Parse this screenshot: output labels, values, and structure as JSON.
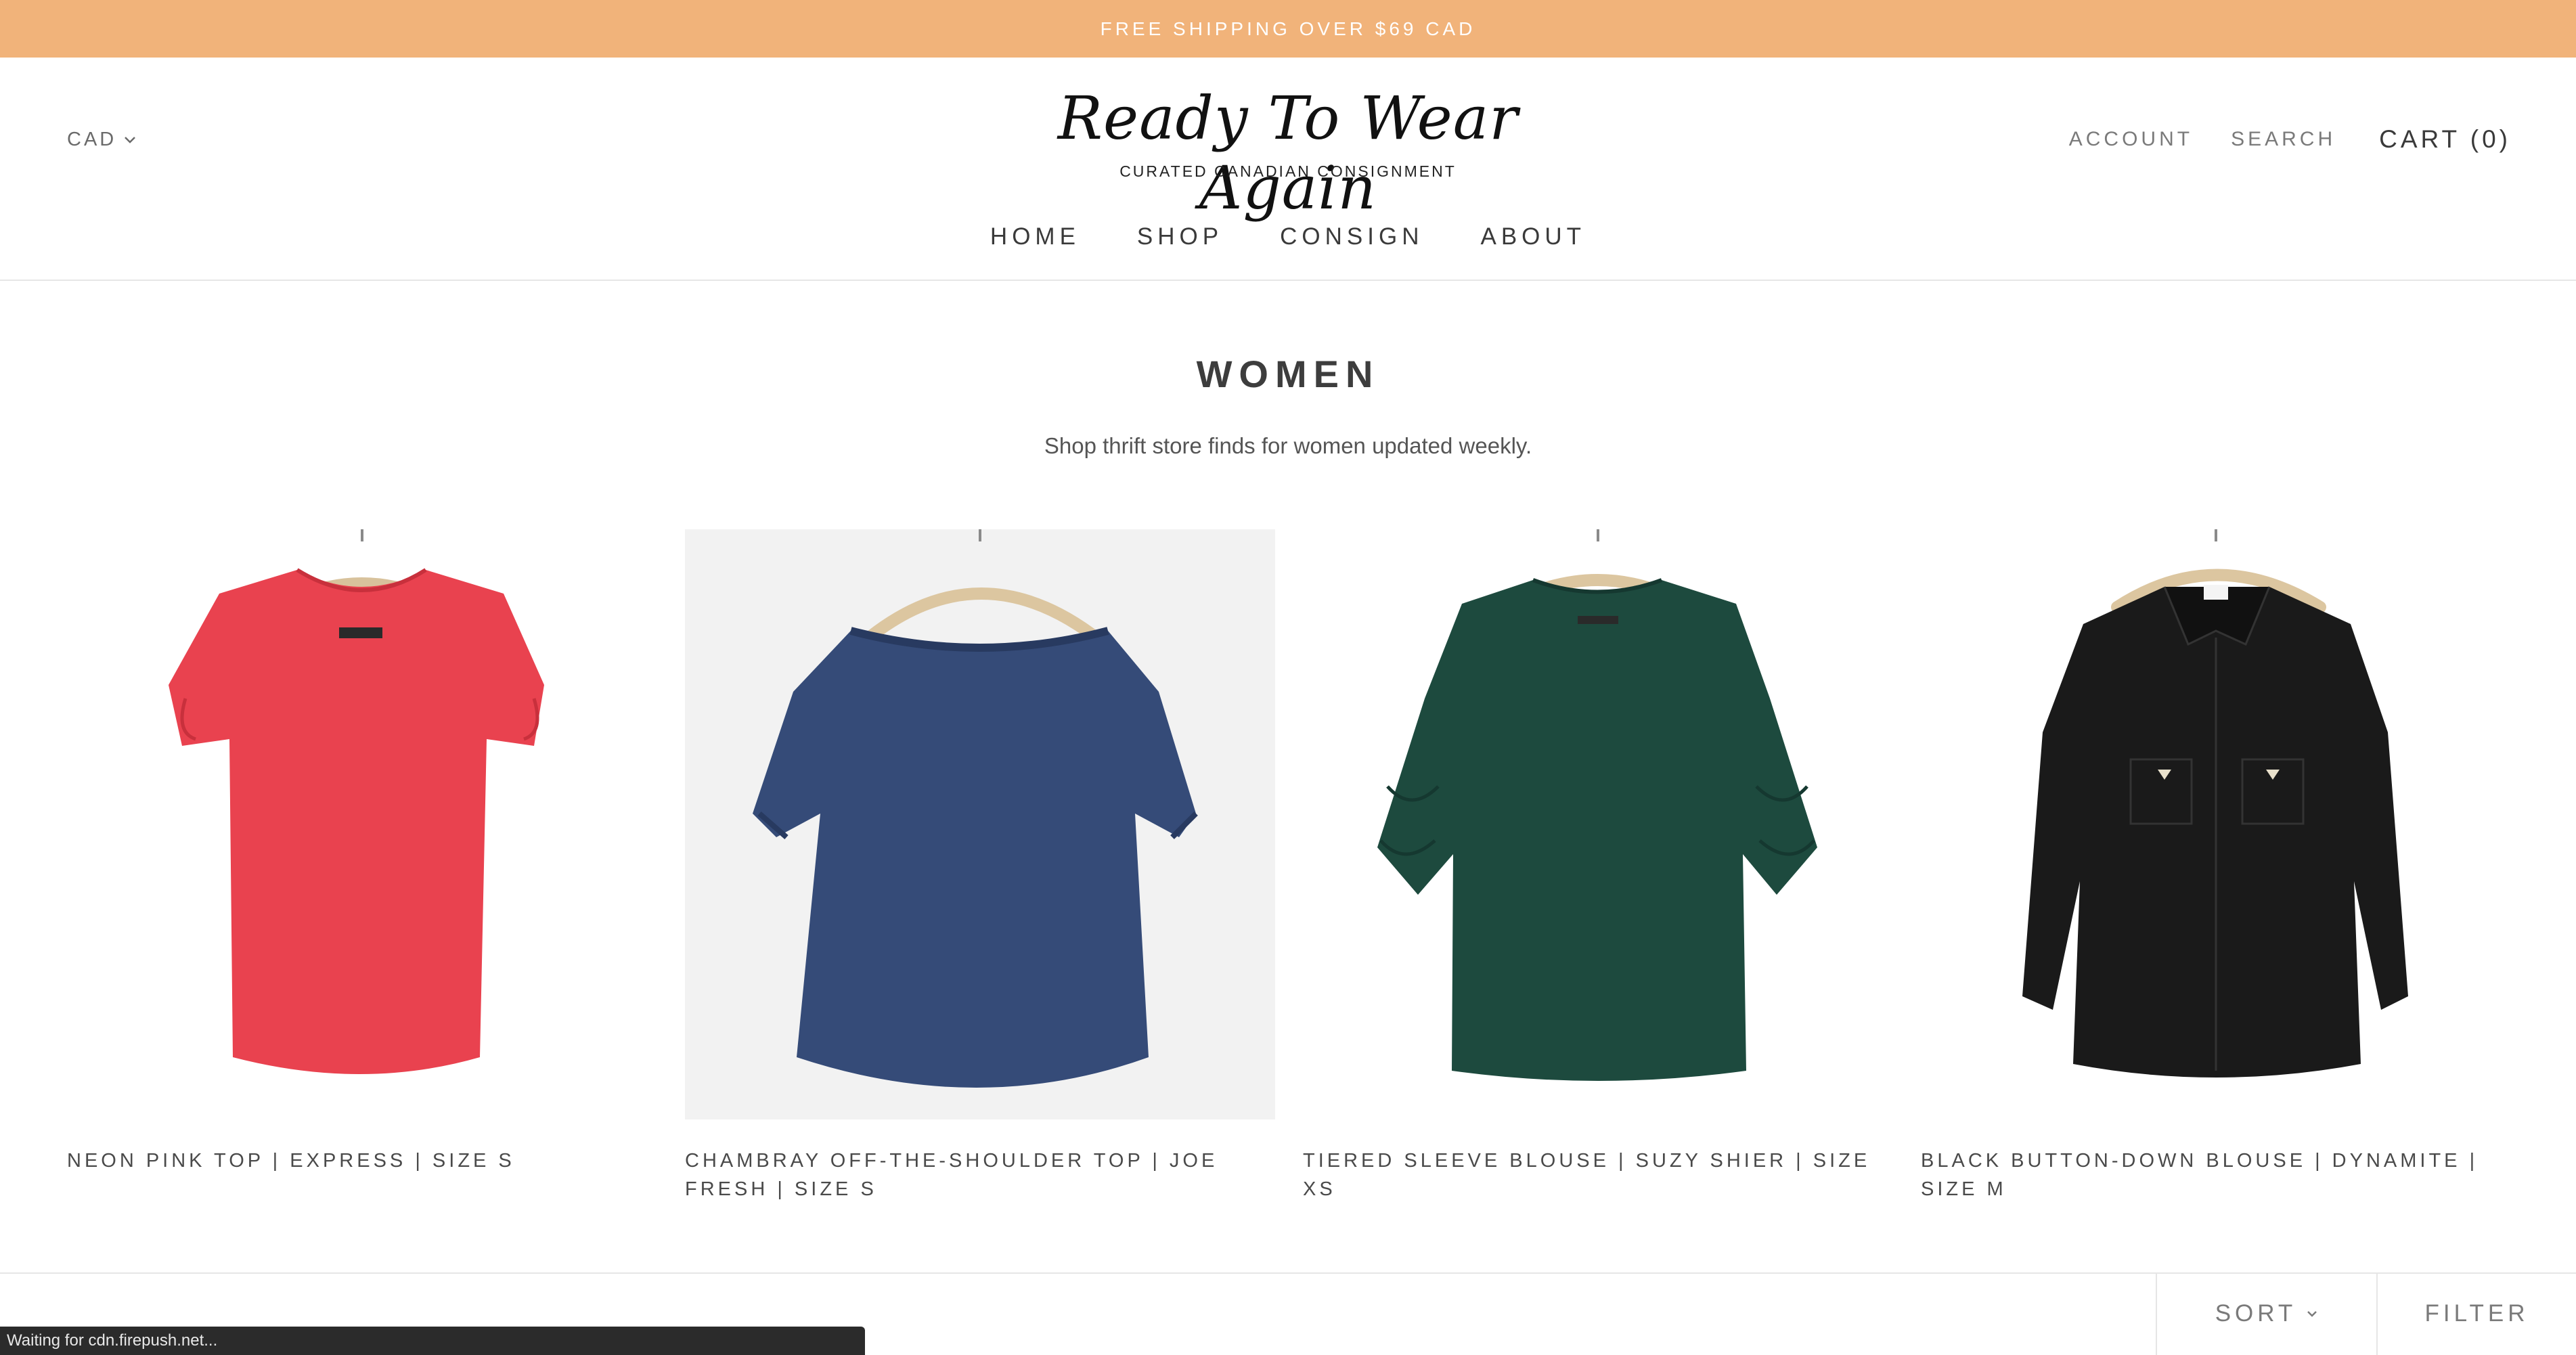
{
  "announcement": {
    "text": "FREE SHIPPING OVER $69 CAD"
  },
  "header": {
    "currency": "CAD",
    "logo_text": "Ready To Wear Again",
    "logo_tagline": "CURATED CANADIAN CONSIGNMENT",
    "account_label": "ACCOUNT",
    "search_label": "SEARCH",
    "cart_label": "CART (0)"
  },
  "nav": {
    "items": [
      {
        "label": "HOME"
      },
      {
        "label": "SHOP"
      },
      {
        "label": "CONSIGN"
      },
      {
        "label": "ABOUT"
      }
    ]
  },
  "collection": {
    "title": "WOMEN",
    "description": "Shop thrift store finds for women updated weekly."
  },
  "products": [
    {
      "title": "NEON PINK TOP | EXPRESS | SIZE S",
      "color": "#e9424f"
    },
    {
      "title": "CHAMBRAY OFF-THE-SHOULDER TOP | JOE FRESH | SIZE S",
      "color": "#354b78"
    },
    {
      "title": "TIERED SLEEVE BLOUSE | SUZY SHIER | SIZE XS",
      "color": "#1d4a3e"
    },
    {
      "title": "BLACK BUTTON-DOWN BLOUSE | DYNAMITE | SIZE M",
      "color": "#1a1a1a"
    }
  ],
  "toolbar": {
    "sort_label": "SORT",
    "filter_label": "FILTER"
  },
  "status_bar": {
    "text": "Waiting for cdn.firepush.net..."
  },
  "colors": {
    "announcement_bg": "#f1b37a",
    "text": "#3d3d3d"
  },
  "icons": {
    "currency_chevron": "chevron-down-icon",
    "sort_chevron": "chevron-down-icon"
  }
}
